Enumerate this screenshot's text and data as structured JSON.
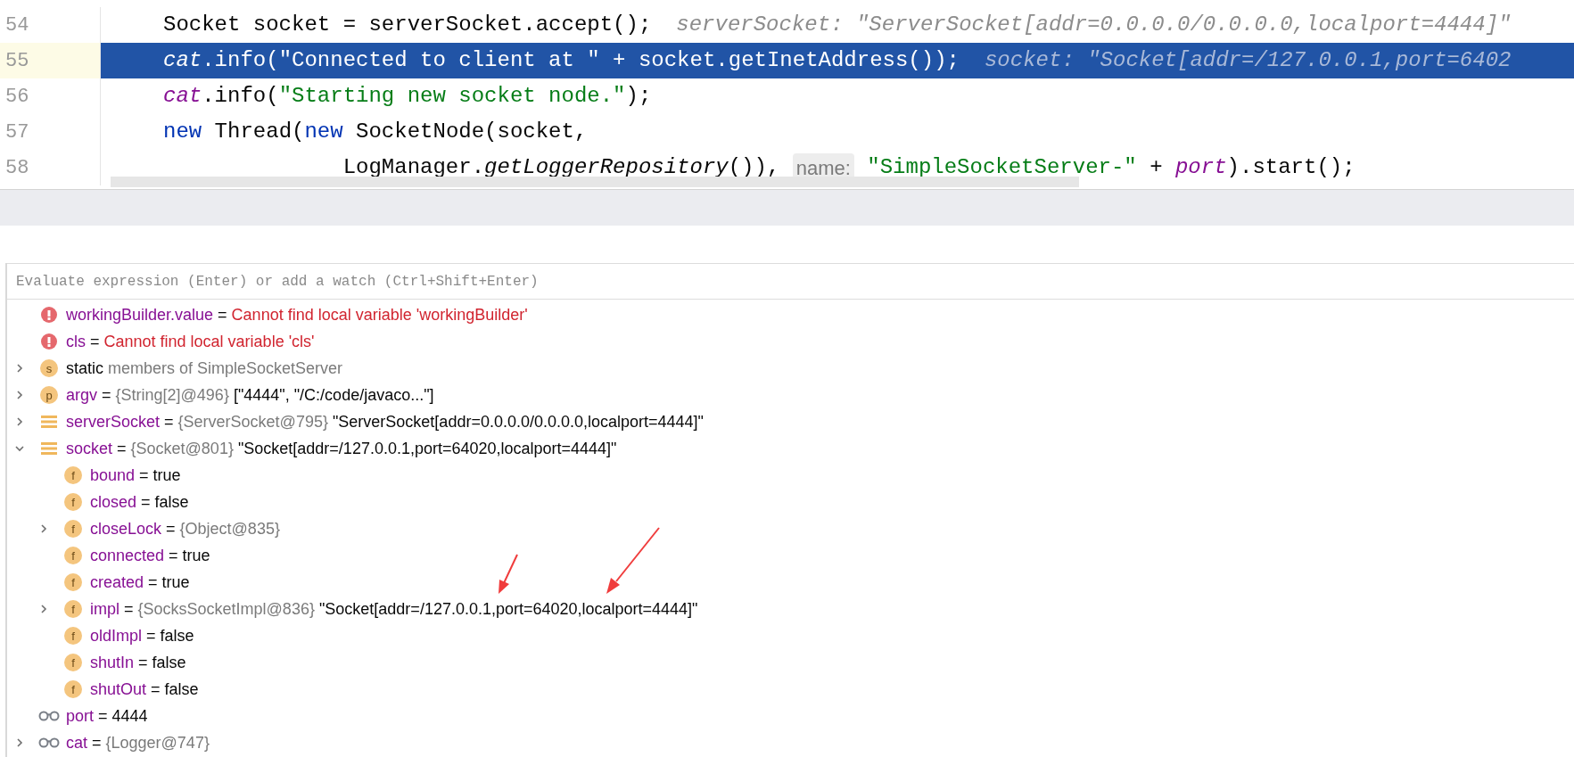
{
  "editor": {
    "lines": [
      {
        "number": "54",
        "selected": false,
        "tokens": [
          {
            "kind": "plain",
            "text": "Socket socket = serverSocket.accept();"
          }
        ],
        "hint": "serverSocket: \"ServerSocket[addr=0.0.0.0/0.0.0.0,localport=4444]\""
      },
      {
        "number": "55",
        "selected": true,
        "tokens": [
          {
            "kind": "static",
            "text": "cat"
          },
          {
            "kind": "plain",
            "text": ".info("
          },
          {
            "kind": "string",
            "text": "\"Connected to client at \""
          },
          {
            "kind": "plain",
            "text": " + socket.getInetAddress());"
          }
        ],
        "hint": "socket: \"Socket[addr=/127.0.0.1,port=6402"
      },
      {
        "number": "56",
        "selected": false,
        "tokens": [
          {
            "kind": "static",
            "text": "cat"
          },
          {
            "kind": "plain",
            "text": ".info("
          },
          {
            "kind": "string",
            "text": "\"Starting new socket node.\""
          },
          {
            "kind": "plain",
            "text": ");"
          }
        ]
      },
      {
        "number": "57",
        "selected": false,
        "tokens": [
          {
            "kind": "keyword",
            "text": "new"
          },
          {
            "kind": "plain",
            "text": " Thread("
          },
          {
            "kind": "keyword",
            "text": "new"
          },
          {
            "kind": "plain",
            "text": " SocketNode(socket,"
          }
        ]
      },
      {
        "number": "58",
        "selected": false,
        "tokens": [
          {
            "kind": "plain",
            "text": "              LogManager."
          },
          {
            "kind": "italic",
            "text": "getLoggerRepository"
          },
          {
            "kind": "plain",
            "text": "()), "
          },
          {
            "kind": "param",
            "text": "name:"
          },
          {
            "kind": "string",
            "text": " \"SimpleSocketServer-\""
          },
          {
            "kind": "plain",
            "text": " + "
          },
          {
            "kind": "static",
            "text": "port"
          },
          {
            "kind": "plain",
            "text": ").start();"
          }
        ]
      }
    ]
  },
  "watch_field": {
    "placeholder": "Evaluate expression (Enter) or add a watch (Ctrl+Shift+Enter)"
  },
  "variables": [
    {
      "kind": "error",
      "name": "workingBuilder.value",
      "sep": "=",
      "error": "Cannot find local variable 'workingBuilder'"
    },
    {
      "kind": "error",
      "name": "cls",
      "sep": "=",
      "error": "Cannot find local variable 'cls'"
    },
    {
      "kind": "static",
      "icon_text": "s",
      "label": "static",
      "note": "members of SimpleSocketServer",
      "expanded": false
    },
    {
      "kind": "param",
      "icon_text": "p",
      "name": "argv",
      "sep": "=",
      "type": "{String[2]@496}",
      "value": "[\"4444\", \"/C:/code/javaco...\"]",
      "expanded": false
    },
    {
      "kind": "object",
      "name": "serverSocket",
      "sep": "=",
      "type": "{ServerSocket@795}",
      "value": "\"ServerSocket[addr=0.0.0.0/0.0.0.0,localport=4444]\"",
      "expanded": false
    },
    {
      "kind": "object",
      "name": "socket",
      "sep": "=",
      "type": "{Socket@801}",
      "value": "\"Socket[addr=/127.0.0.1,port=64020,localport=4444]\"",
      "expanded": true,
      "children": [
        {
          "kind": "field",
          "icon_text": "f",
          "name": "bound",
          "sep": "=",
          "value": "true"
        },
        {
          "kind": "field",
          "icon_text": "f",
          "name": "closed",
          "sep": "=",
          "value": "false"
        },
        {
          "kind": "field",
          "icon_text": "f",
          "name": "closeLock",
          "sep": "=",
          "type": "{Object@835}",
          "expanded": false
        },
        {
          "kind": "field",
          "icon_text": "f",
          "name": "connected",
          "sep": "=",
          "value": "true"
        },
        {
          "kind": "field",
          "icon_text": "f",
          "name": "created",
          "sep": "=",
          "value": "true"
        },
        {
          "kind": "field",
          "icon_text": "f",
          "name": "impl",
          "sep": "=",
          "type": "{SocksSocketImpl@836}",
          "value": "\"Socket[addr=/127.0.0.1,port=64020,localport=4444]\"",
          "expanded": false
        },
        {
          "kind": "field",
          "icon_text": "f",
          "name": "oldImpl",
          "sep": "=",
          "value": "false"
        },
        {
          "kind": "field",
          "icon_text": "f",
          "name": "shutIn",
          "sep": "=",
          "value": "false"
        },
        {
          "kind": "field",
          "icon_text": "f",
          "name": "shutOut",
          "sep": "=",
          "value": "false"
        }
      ]
    },
    {
      "kind": "watch",
      "name": "port",
      "sep": "=",
      "value": "4444"
    },
    {
      "kind": "watch",
      "name": "cat",
      "sep": "=",
      "type": "{Logger@747}",
      "expanded": false
    }
  ]
}
